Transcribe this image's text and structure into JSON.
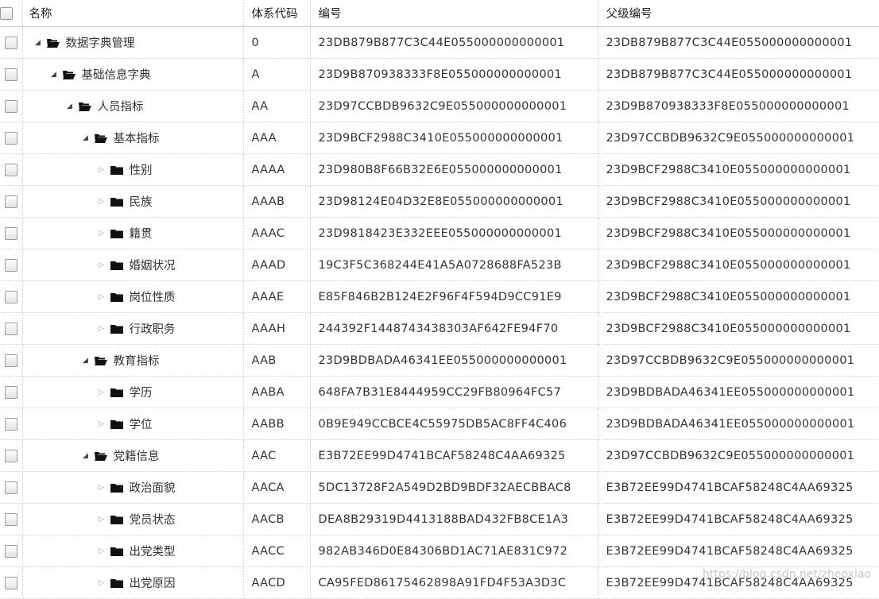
{
  "columns": {
    "name": "名称",
    "code": "体系代码",
    "num": "编号",
    "pnum": "父级编号"
  },
  "rows": [
    {
      "name": "数据字典管理",
      "code": "0",
      "num": "23DB879B877C3C44E055000000000001",
      "pnum": "23DB879B877C3C44E055000000000001",
      "level": 0,
      "state": "open"
    },
    {
      "name": "基础信息字典",
      "code": "A",
      "num": "23D9B870938333F8E055000000000001",
      "pnum": "23DB879B877C3C44E055000000000001",
      "level": 1,
      "state": "open"
    },
    {
      "name": "人员指标",
      "code": "AA",
      "num": "23D97CCBDB9632C9E055000000000001",
      "pnum": "23D9B870938333F8E055000000000001",
      "level": 2,
      "state": "open"
    },
    {
      "name": "基本指标",
      "code": "AAA",
      "num": "23D9BCF2988C3410E055000000000001",
      "pnum": "23D97CCBDB9632C9E055000000000001",
      "level": 3,
      "state": "open"
    },
    {
      "name": "性别",
      "code": "AAAA",
      "num": "23D980B8F66B32E6E055000000000001",
      "pnum": "23D9BCF2988C3410E055000000000001",
      "level": 4,
      "state": "closed"
    },
    {
      "name": "民族",
      "code": "AAAB",
      "num": "23D98124E04D32E8E055000000000001",
      "pnum": "23D9BCF2988C3410E055000000000001",
      "level": 4,
      "state": "closed"
    },
    {
      "name": "籍贯",
      "code": "AAAC",
      "num": "23D9818423E332EEE055000000000001",
      "pnum": "23D9BCF2988C3410E055000000000001",
      "level": 4,
      "state": "closed"
    },
    {
      "name": "婚姻状况",
      "code": "AAAD",
      "num": "19C3F5C368244E41A5A0728688FA523B",
      "pnum": "23D9BCF2988C3410E055000000000001",
      "level": 4,
      "state": "closed"
    },
    {
      "name": "岗位性质",
      "code": "AAAE",
      "num": "E85F846B2B124E2F96F4F594D9CC91E9",
      "pnum": "23D9BCF2988C3410E055000000000001",
      "level": 4,
      "state": "closed"
    },
    {
      "name": "行政职务",
      "code": "AAAH",
      "num": "244392F1448743438303AF642FE94F70",
      "pnum": "23D9BCF2988C3410E055000000000001",
      "level": 4,
      "state": "closed"
    },
    {
      "name": "教育指标",
      "code": "AAB",
      "num": "23D9BDBADA46341EE055000000000001",
      "pnum": "23D97CCBDB9632C9E055000000000001",
      "level": 3,
      "state": "open"
    },
    {
      "name": "学历",
      "code": "AABA",
      "num": "648FA7B31E8444959CC29FB80964FC57",
      "pnum": "23D9BDBADA46341EE055000000000001",
      "level": 4,
      "state": "closed"
    },
    {
      "name": "学位",
      "code": "AABB",
      "num": "0B9E949CCBCE4C55975DB5AC8FF4C406",
      "pnum": "23D9BDBADA46341EE055000000000001",
      "level": 4,
      "state": "closed"
    },
    {
      "name": "党籍信息",
      "code": "AAC",
      "num": "E3B72EE99D4741BCAF58248C4AA69325",
      "pnum": "23D97CCBDB9632C9E055000000000001",
      "level": 3,
      "state": "open"
    },
    {
      "name": "政治面貌",
      "code": "AACA",
      "num": "5DC13728F2A549D2BD9BDF32AECBBAC8",
      "pnum": "E3B72EE99D4741BCAF58248C4AA69325",
      "level": 4,
      "state": "closed"
    },
    {
      "name": "党员状态",
      "code": "AACB",
      "num": "DEA8B29319D4413188BAD432FB8CE1A3",
      "pnum": "E3B72EE99D4741BCAF58248C4AA69325",
      "level": 4,
      "state": "closed"
    },
    {
      "name": "出党类型",
      "code": "AACC",
      "num": "982AB346D0E84306BD1AC71AE831C972",
      "pnum": "E3B72EE99D4741BCAF58248C4AA69325",
      "level": 4,
      "state": "closed"
    },
    {
      "name": "出党原因",
      "code": "AACD",
      "num": "CA95FED86175462898A91FD4F53A3D3C",
      "pnum": "E3B72EE99D4741BCAF58248C4AA69325",
      "level": 4,
      "state": "closed"
    }
  ],
  "watermark": "https://blog.csdn.net/zheoxiao"
}
